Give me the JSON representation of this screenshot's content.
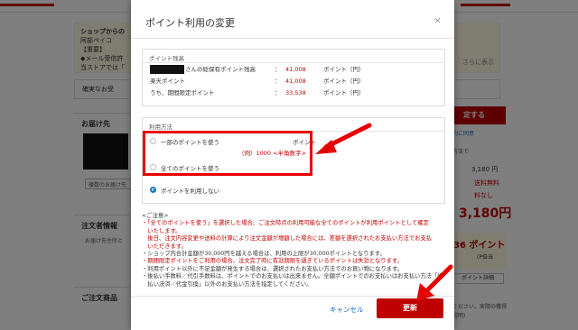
{
  "background": {
    "shop_box": {
      "title": "ショップからの",
      "shop": "阿部ペイコ",
      "important": "【重要】",
      "line1": "◆メール受信許",
      "line2": "当ストアでは「",
      "more": "さらに表示"
    },
    "banner": "確実なお受",
    "delivery_title": "お届け先",
    "multi_delivery_btn": "複数のお届け先",
    "orderer_title": "注文者情報",
    "orderer_sub": "お届け先住所と",
    "product_title": "ご注文商品",
    "confirm_button": "定する",
    "right_text1": "規約に同意",
    "right_text2": "い方法で",
    "price1": "3,180 円",
    "shipping": "送料無料",
    "fee": "料なし",
    "total": "3,180円",
    "points": "36 ポイント",
    "points_sub": "(P倍当",
    "point_detail_btn": "ポイント詳細",
    "bottom_right": "意ください。実際の獲得",
    "bottom_right2": "品説明)"
  },
  "modal": {
    "title": "ポイント利用の変更",
    "close_icon": "×",
    "balance_section": {
      "heading": "ポイント残高",
      "rows": [
        {
          "label_suffix": "さんの総保有ポイント残高",
          "colon": "：",
          "value": "41,008",
          "unit": "ポイント（円）",
          "redacted": true
        },
        {
          "label": "楽天ポイント",
          "colon": "：",
          "value": "41,008",
          "unit": "ポイント（円）"
        },
        {
          "label": "うち、期間限定ポイント",
          "colon": "：",
          "value": "33,538",
          "unit": "ポイント（円）"
        }
      ]
    },
    "use_section": {
      "heading": "利用方法",
      "partial_label": "一部のポイントを使う",
      "partial_unit": "ポイント",
      "partial_hint": "（例）1000 <半角数字>",
      "all_label": "全てのポイントを使う",
      "none_label": "ポイントを利用しない",
      "selected": "none"
    },
    "notes": {
      "heading": "<ご注意>",
      "lines": [
        {
          "text": "・「全てのポイントを使う」を選択した場合、ご注文時点の利用可能な全てのポイントが利用ポイントとして確定",
          "red": true
        },
        {
          "text": "　いたします。",
          "red": true
        },
        {
          "text": "　後日、注文内容変更や送料の計算により注文金額が増額した場合には、差額を選択されたお支払い方法でお支払",
          "red": true
        },
        {
          "text": "　いただきます。",
          "red": true
        },
        {
          "text": "・ショップ内合計金額が30,000円を越える場合は、利用の上限が30,000ポイントとなります。",
          "red": false
        },
        {
          "text": "・期間限定ポイントをご利用の場合、注文完了時に有効期限を過ぎているポイントは失効となります。",
          "red": true
        },
        {
          "text": "・利用ポイント以外に不足金額が発生する場合は、選択されたお支払い方法でのお買い物になります。",
          "red": false
        },
        {
          "text": "・後払い手数料／代引手数料は、ポイントでのお支払いは出来ません。全額ポイントでのお支払いはお支払い方法「後",
          "red": false
        },
        {
          "text": "　払い決済／代金引換」以外のお支払い方法を指定してください。",
          "red": false
        }
      ]
    },
    "cancel_label": "キャンセル",
    "update_label": "更新"
  },
  "colors": {
    "accent_red": "#bf0000",
    "annotation_red": "#e60000",
    "link_blue": "#1a5fb4"
  }
}
